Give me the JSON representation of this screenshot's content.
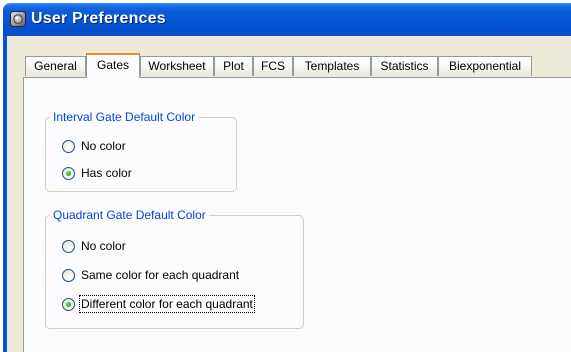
{
  "window": {
    "title": "User Preferences",
    "icon": "app-icon"
  },
  "tabs": [
    {
      "label": "General",
      "active": false
    },
    {
      "label": "Gates",
      "active": true
    },
    {
      "label": "Worksheet",
      "active": false
    },
    {
      "label": "Plot",
      "active": false
    },
    {
      "label": "FCS",
      "active": false
    },
    {
      "label": "Templates",
      "active": false
    },
    {
      "label": "Statistics",
      "active": false
    },
    {
      "label": "Biexponential",
      "active": false
    }
  ],
  "interval_group": {
    "legend": "Interval Gate Default Color",
    "options": [
      {
        "label": "No color",
        "selected": false
      },
      {
        "label": "Has color",
        "selected": true
      }
    ]
  },
  "quadrant_group": {
    "legend": "Quadrant Gate Default Color",
    "options": [
      {
        "label": "No color",
        "selected": false
      },
      {
        "label": "Same color for each quadrant",
        "selected": false
      },
      {
        "label": "Different color for each quadrant",
        "selected": true
      }
    ]
  },
  "colors": {
    "legend_text": "#0046d5",
    "titlebar": "#0555d3",
    "active_tab_highlight": "#e68b2c",
    "radio_selected": "#21a121"
  }
}
